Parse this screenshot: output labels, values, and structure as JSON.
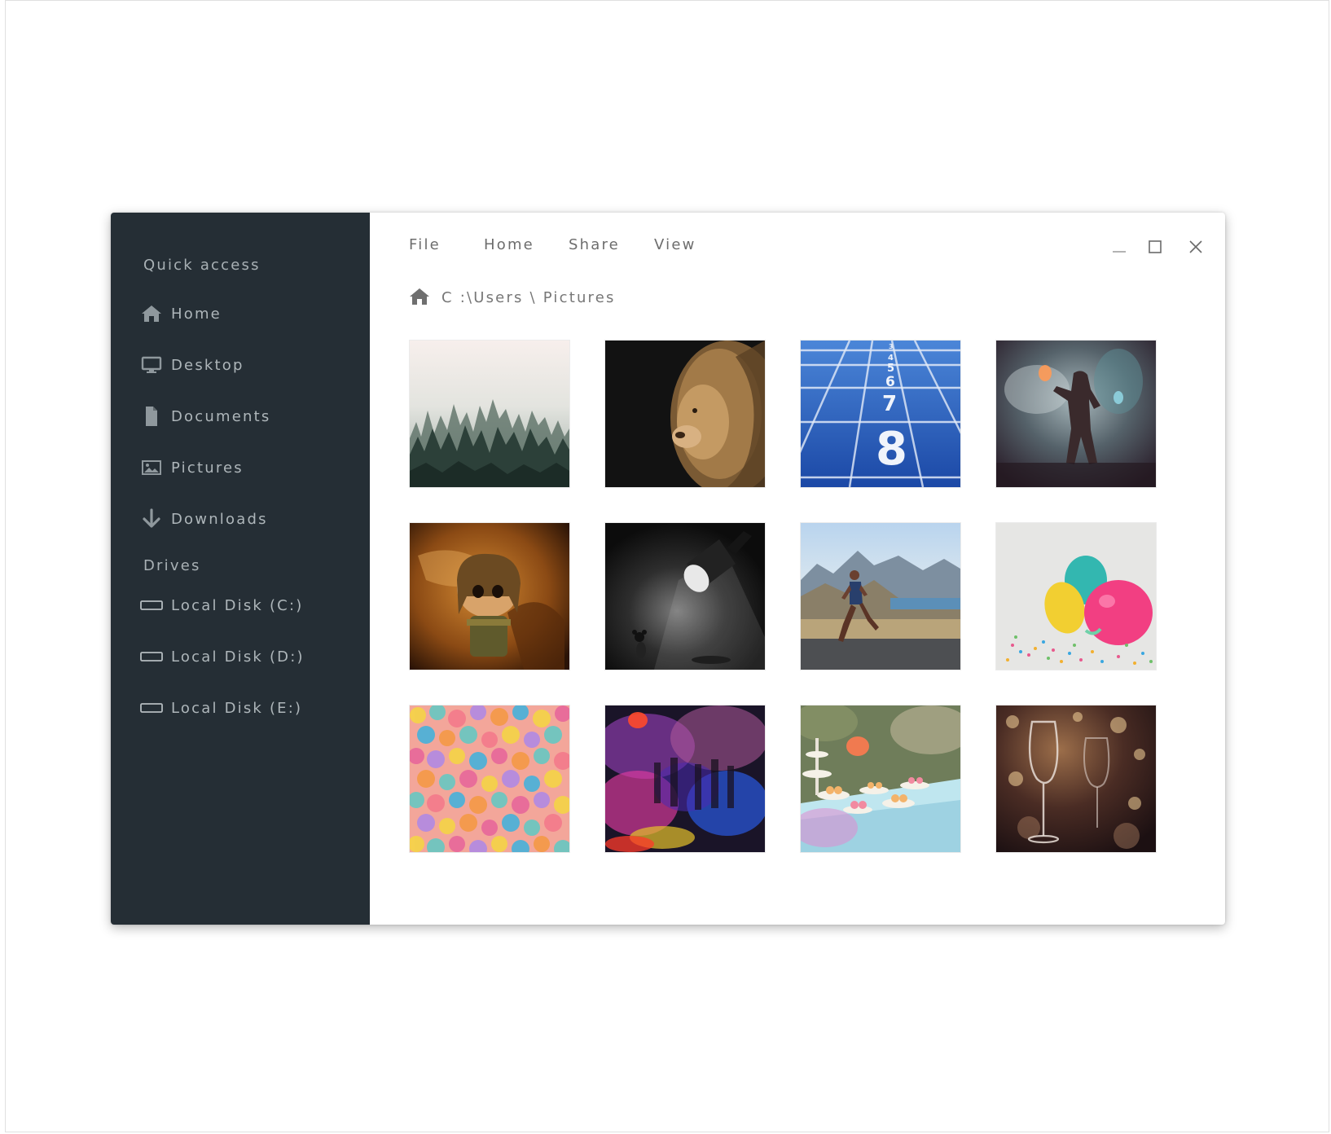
{
  "menu": {
    "file": "File",
    "home": "Home",
    "share": "Share",
    "view": "View"
  },
  "window_controls": [
    "minimize-icon",
    "maximize-icon",
    "close-icon"
  ],
  "breadcrumb": {
    "icon": "home-icon",
    "path": "C :\\Users \\ Pictures"
  },
  "sidebar": {
    "quick_access_heading": "Quick access",
    "quick_access": [
      {
        "label": "Home",
        "icon": "home-icon"
      },
      {
        "label": "Desktop",
        "icon": "desktop-icon"
      },
      {
        "label": "Documents",
        "icon": "document-icon"
      },
      {
        "label": "Pictures",
        "icon": "image-icon"
      },
      {
        "label": "Downloads",
        "icon": "download-arrow-icon"
      }
    ],
    "drives_heading": "Drives",
    "drives": [
      {
        "label": "Local Disk (C:)",
        "icon": "drive-icon"
      },
      {
        "label": "Local Disk (D:)",
        "icon": "drive-icon"
      },
      {
        "label": "Local Disk (E:)",
        "icon": "drive-icon"
      }
    ]
  },
  "photos": [
    {
      "name": "misty-forest"
    },
    {
      "name": "lion"
    },
    {
      "name": "running-track-lanes",
      "lane_numbers": [
        "3",
        "4",
        "5",
        "6",
        "7",
        "8"
      ]
    },
    {
      "name": "person-in-smoke"
    },
    {
      "name": "toy-figure"
    },
    {
      "name": "spotlight-lamp"
    },
    {
      "name": "runner-on-road"
    },
    {
      "name": "balloons-confetti"
    },
    {
      "name": "confetti-closeup"
    },
    {
      "name": "color-smoke-crowd"
    },
    {
      "name": "dessert-table"
    },
    {
      "name": "wine-glasses"
    }
  ],
  "colors": {
    "sidebar_bg": "#252e35",
    "sidebar_text": "#aeb6ba",
    "menu_text": "#6d6d6d",
    "window_bg": "#ffffff"
  }
}
